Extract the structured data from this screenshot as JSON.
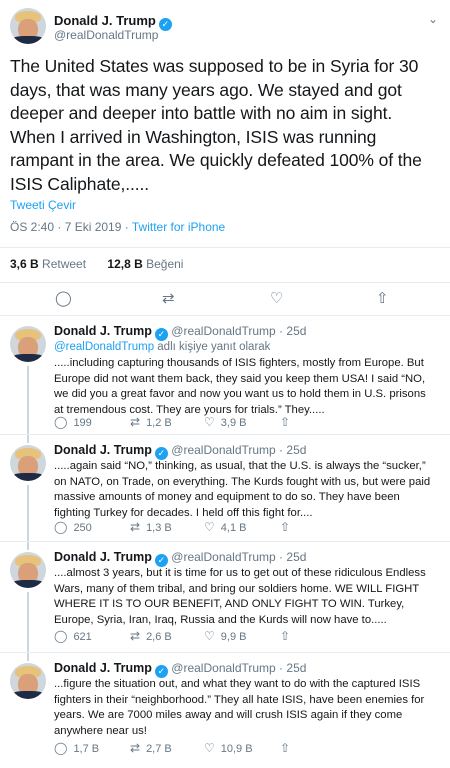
{
  "main_tweet": {
    "name": "Donald J. Trump",
    "handle": "@realDonaldTrump",
    "text": "The United States was supposed to be in Syria for 30 days, that was many years ago. We stayed and got deeper and deeper into battle with no aim in sight. When I arrived in Washington, ISIS was running rampant in the area. We quickly defeated 100% of the ISIS Caliphate,.....",
    "translate": "Tweeti Çevir",
    "time": "ÖS 2:40 · 7 Eki 2019 · ",
    "source": "Twitter for iPhone",
    "retweets_count": "3,6 B",
    "retweets_label": "Retweet",
    "likes_count": "12,8 B",
    "likes_label": "Beğeni"
  },
  "replies": [
    {
      "name": "Donald J. Trump",
      "handle": "@realDonaldTrump · 25d",
      "in_reply_handle": "@realDonaldTrump",
      "in_reply_text": " adlı kişiye yanıt olarak",
      "text": ".....including capturing thousands of ISIS fighters, mostly from Europe. But Europe did not want them back, they said you keep them USA! I said “NO, we did you a great favor and now you want us to hold them in U.S. prisons at tremendous cost. They are yours for trials.” They.....",
      "replies": "199",
      "retweets": "1,2 B",
      "likes": "3,9 B"
    },
    {
      "name": "Donald J. Trump",
      "handle": "@realDonaldTrump · 25d",
      "text": ".....again said “NO,” thinking, as usual, that the U.S. is always the “sucker,” on NATO, on Trade, on everything. The Kurds fought with us, but were paid massive amounts of money and equipment to do so. They have been fighting Turkey for decades. I held off this fight for....",
      "replies": "250",
      "retweets": "1,3 B",
      "likes": "4,1 B"
    },
    {
      "name": "Donald J. Trump",
      "handle": "@realDonaldTrump · 25d",
      "text": "....almost 3 years, but it is time for us to get out of these ridiculous Endless Wars, many of them tribal, and bring our soldiers home. WE WILL FIGHT WHERE IT IS TO OUR BENEFIT, AND ONLY FIGHT TO WIN. Turkey, Europe, Syria, Iran, Iraq, Russia and the Kurds will now have to.....",
      "replies": "621",
      "retweets": "2,6 B",
      "likes": "9,9 B"
    },
    {
      "name": "Donald J. Trump",
      "handle": "@realDonaldTrump · 25d",
      "text": "...figure the situation out, and what they want to do with the captured ISIS fighters in their “neighborhood.” They all hate ISIS, have been enemies for years. We are 7000 miles away and will crush ISIS again if they come anywhere near us!",
      "replies": "1,7 B",
      "retweets": "2,7 B",
      "likes": "10,9 B"
    }
  ],
  "icons": {
    "verified": "✓",
    "caret": "⌄",
    "reply": "◯",
    "retweet": "⇄",
    "like": "♡",
    "share": "⇧"
  }
}
